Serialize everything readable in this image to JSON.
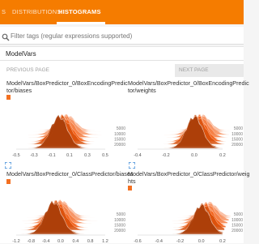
{
  "nav": {
    "tabs": [
      {
        "label": "S"
      },
      {
        "label": "DISTRIBUTIONS"
      },
      {
        "label": "HISTOGRAMS"
      }
    ]
  },
  "filter": {
    "placeholder": "Filter tags (regular expressions supported)"
  },
  "group": {
    "title": "ModelVars",
    "prev_label": "PREVIOUS PAGE",
    "next_label": "NEXT PAGE"
  },
  "accent_color": "#f57c00",
  "series_color": "#f37021",
  "chart_data": [
    {
      "type": "histogram",
      "title": "ModelVars/BoxPredictor_0/BoxEncodingPredictor/biases",
      "title_lines": [
        "ModelVars/BoxPredictor_0/BoxEncodingPredic",
        "tor/biases"
      ],
      "x_ticks": [
        "-0.5",
        "-0.3",
        "-0.1",
        "0.1",
        "0.3",
        "0.5"
      ],
      "steps": [
        "20000",
        "15000",
        "10000",
        "5000"
      ],
      "peak_x": -0.02
    },
    {
      "type": "histogram",
      "title": "ModelVars/BoxPredictor_0/BoxEncodingPredictor/weights",
      "title_lines": [
        "ModelVars/BoxPredictor_0/BoxEncodingPredic",
        "tor/weights"
      ],
      "x_ticks": [
        "-0.4",
        "-0.2",
        "0.0",
        "0.2"
      ],
      "steps": [
        "20000",
        "15000",
        "10000",
        "5000"
      ],
      "peak_x": 0.0
    },
    {
      "type": "histogram",
      "title": "ModelVars/BoxPredictor_0/ClassPredictor/biases",
      "title_lines": [
        "ModelVars/BoxPredictor_0/ClassPredictor/biases"
      ],
      "x_ticks": [
        "-1.2",
        "-0.8",
        "-0.4",
        "0.0",
        "0.4",
        "0.8",
        "1.2"
      ],
      "steps": [
        "20000",
        "15000",
        "10000",
        "5000"
      ],
      "peak_x": -0.2
    },
    {
      "type": "histogram",
      "title": "ModelVars/BoxPredictor_0/ClassPredictor/weights",
      "title_lines": [
        "ModelVars/BoxPredictor_0/ClassPredictor/weig",
        "hts"
      ],
      "x_ticks": [
        "-0.6",
        "-0.4",
        "-0.2",
        "0.0",
        "0.2"
      ],
      "steps": [
        "20000",
        "15000",
        "10000",
        "5000"
      ],
      "peak_x": 0.0
    }
  ]
}
